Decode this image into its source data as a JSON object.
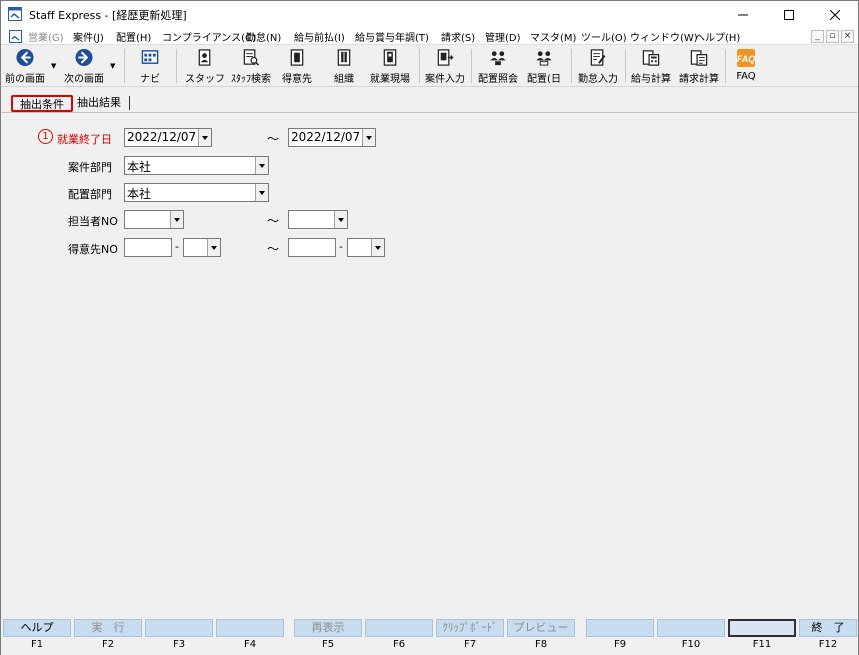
{
  "window": {
    "title": "Staff Express - [経歴更新処理]"
  },
  "menu": {
    "items": [
      {
        "label": "営業(G)",
        "enabled": false
      },
      {
        "label": "案件(J)",
        "enabled": true
      },
      {
        "label": "配置(H)",
        "enabled": true
      },
      {
        "label": "コンプライアンス(C)",
        "enabled": true
      },
      {
        "label": "勤怠(N)",
        "enabled": true
      },
      {
        "label": "給与前払(I)",
        "enabled": true
      },
      {
        "label": "給与賞与年調(T)",
        "enabled": true
      },
      {
        "label": "請求(S)",
        "enabled": true
      },
      {
        "label": "管理(D)",
        "enabled": true
      },
      {
        "label": "マスタ(M)",
        "enabled": true
      },
      {
        "label": "ツール(O)",
        "enabled": true
      },
      {
        "label": "ウィンドウ(W)",
        "enabled": true
      },
      {
        "label": "ヘルプ(H)",
        "enabled": true
      }
    ]
  },
  "toolbar": {
    "buttons": [
      {
        "label": "前の画面",
        "icon": "back-arrow-icon"
      },
      {
        "label": "次の画面",
        "icon": "forward-arrow-icon"
      },
      {
        "label": "ナビ",
        "icon": "navi-icon"
      },
      {
        "label": "スタッフ",
        "icon": "staff-icon"
      },
      {
        "label": "ｽﾀｯﾌ検索",
        "icon": "staff-search-icon"
      },
      {
        "label": "得意先",
        "icon": "customer-icon"
      },
      {
        "label": "組織",
        "icon": "organization-icon"
      },
      {
        "label": "就業現場",
        "icon": "worksite-icon"
      },
      {
        "label": "案件入力",
        "icon": "case-entry-icon"
      },
      {
        "label": "配置照会",
        "icon": "placement-inquiry-icon"
      },
      {
        "label": "配置(日",
        "icon": "placement-daily-icon"
      },
      {
        "label": "勤怠入力",
        "icon": "attendance-entry-icon"
      },
      {
        "label": "給与計算",
        "icon": "payroll-calc-icon"
      },
      {
        "label": "請求計算",
        "icon": "billing-calc-icon"
      },
      {
        "label": "FAQ",
        "icon": "faq-icon"
      }
    ]
  },
  "tabs": [
    {
      "label": "抽出条件",
      "active": true
    },
    {
      "label": "抽出結果",
      "active": false
    }
  ],
  "form": {
    "marker": "1",
    "range_separator": "～",
    "code_separator": "-",
    "work_end_date": {
      "label": "就業終了日",
      "from": "2022/12/07",
      "to": "2022/12/07"
    },
    "case_dept": {
      "label": "案件部門",
      "value": "本社"
    },
    "placement_dept": {
      "label": "配置部門",
      "value": "本社"
    },
    "staff_no": {
      "label": "担当者NO",
      "from": "",
      "to": ""
    },
    "customer_no": {
      "label": "得意先NO",
      "from": "",
      "from_sub": "",
      "to": "",
      "to_sub": ""
    }
  },
  "fkeys": [
    {
      "label": "ヘルプ",
      "key": "F1",
      "enabled": true
    },
    {
      "label": "実　行",
      "key": "F2",
      "enabled": false
    },
    {
      "label": "",
      "key": "F3",
      "enabled": true
    },
    {
      "label": "",
      "key": "F4",
      "enabled": true
    },
    {
      "label": "再表示",
      "key": "F5",
      "enabled": false
    },
    {
      "label": "",
      "key": "F6",
      "enabled": true
    },
    {
      "label": "ｸﾘｯﾌﾟﾎﾞｰﾄﾞ",
      "key": "F7",
      "enabled": false
    },
    {
      "label": "プレビュー",
      "key": "F8",
      "enabled": false
    },
    {
      "label": "",
      "key": "F9",
      "enabled": true
    },
    {
      "label": "",
      "key": "F10",
      "enabled": true
    },
    {
      "label": "",
      "key": "F11",
      "enabled": true
    },
    {
      "label": "終　了",
      "key": "F12",
      "enabled": true
    }
  ]
}
